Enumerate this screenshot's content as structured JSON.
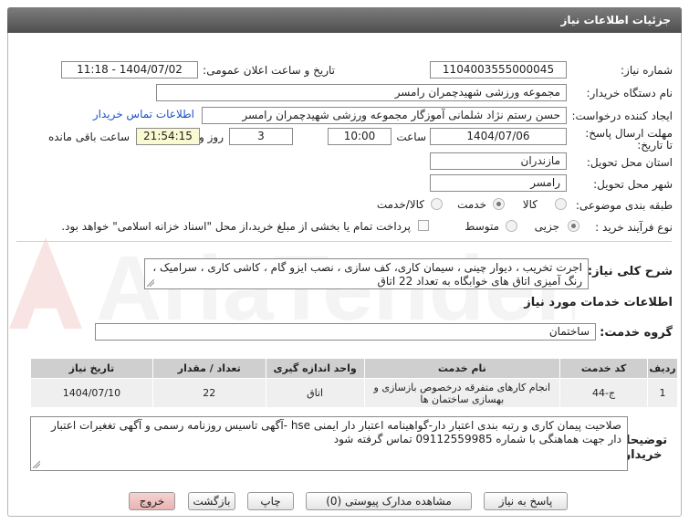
{
  "header": {
    "title": "جزئیات اطلاعات نیاز"
  },
  "form": {
    "need_number_label": "شماره نیاز:",
    "need_number": "1104003555000045",
    "announce_label": "تاریخ و ساعت اعلان عمومی:",
    "announce_value": "1404/07/02 - 11:18",
    "buyer_org_label": "نام دستگاه خریدار:",
    "buyer_org": "مجموعه ورزشی شهیدچمران رامسر",
    "requester_label": "ایجاد کننده درخواست:",
    "requester": "حسن رستم نژاد شلمانی آموزگار مجموعه ورزشی شهیدچمران رامسر",
    "contact_link": "اطلاعات تماس خریدار",
    "deadline_label": "مهلت ارسال پاسخ: تا تاریخ:",
    "deadline_date": "1404/07/06",
    "time_label": "ساعت",
    "deadline_time": "10:00",
    "days_value": "3",
    "days_label": "روز و",
    "remaining_time": "21:54:15",
    "remaining_label": "ساعت باقی مانده",
    "province_label": "استان محل تحویل:",
    "province": "مازندران",
    "city_label": "شهر محل تحویل:",
    "city": "رامسر",
    "category_label": "طبقه بندی موضوعی:",
    "category_options": [
      "کالا",
      "خدمت",
      "کالا/خدمت"
    ],
    "category_selected": "خدمت",
    "process_label": "نوع فرآیند خرید :",
    "process_options": [
      "جزیی",
      "متوسط"
    ],
    "process_selected": "جزیی",
    "payment_note": "پرداخت تمام یا بخشی از مبلغ خرید،از محل \"اسناد خزانه اسلامی\" خواهد بود."
  },
  "description": {
    "label": "شرح کلی نیاز:",
    "text": "اجرت تخریب ، دیوار چینی ، سیمان کاری، کف سازی ، نصب ایزو گام ، کاشی کاری ، سرامیک ، رنگ آمیزی اتاق های خوابگاه به تعداد 22 اتاق"
  },
  "services": {
    "section_title": "اطلاعات خدمات مورد نیاز",
    "group_label": "گروه خدمت:",
    "group_value": "ساختمان",
    "columns": [
      "ردیف",
      "کد خدمت",
      "نام خدمت",
      "واحد اندازه گیری",
      "تعداد / مقدار",
      "تاریخ نیاز"
    ],
    "rows": [
      {
        "row": "1",
        "code": "ج-44",
        "name": "انجام کارهای متفرقه درخصوص بازسازی و بهسازی ساختمان ها",
        "unit": "اتاق",
        "qty": "22",
        "date": "1404/07/10"
      }
    ]
  },
  "buyer_notes": {
    "label": "توضیحات خریدار:",
    "text": "صلاحیت پیمان کاری و رتبه بندی اعتبار دار-گواهینامه اعتبار دار ایمنی hse -آگهی تاسیس روزنامه رسمی و آگهی تغغیرات اعتبار دار  جهت هماهنگی با شماره 09112559985 تماس گرفته شود"
  },
  "buttons": {
    "reply": "پاسخ به نیاز",
    "attachments": "مشاهده مدارک پیوستی (0)",
    "print": "چاپ",
    "back": "بازگشت",
    "exit": "خروج"
  },
  "watermark_text": "AriaTender.net",
  "colors": {
    "header": "#5c5c5c",
    "link": "#1a55c8",
    "highlight": "#fafad2",
    "exit_button": "#e9b3b3"
  }
}
